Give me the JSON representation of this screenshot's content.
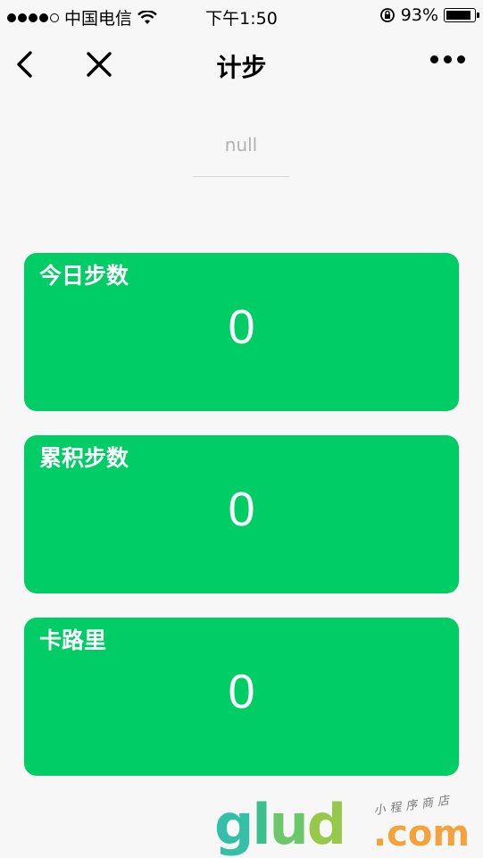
{
  "status_bar": {
    "carrier": "中国电信",
    "time": "下午1:50",
    "battery_percent": "93%",
    "battery_level": 0.93,
    "icons": [
      "signal-dots-icon",
      "wifi-icon",
      "rotation-lock-icon",
      "battery-icon"
    ]
  },
  "nav": {
    "title": "计步",
    "icons": [
      "back-arrow-icon",
      "close-icon",
      "more-icon"
    ]
  },
  "main": {
    "null_text": "null",
    "cards": [
      {
        "label": "今日步数",
        "value": "0"
      },
      {
        "label": "累积步数",
        "value": "0"
      },
      {
        "label": "卡路里",
        "value": "0"
      }
    ],
    "card_color": "#00cd65"
  },
  "watermark": {
    "main": "glud",
    "suffix": ".com",
    "subtitle": "小程序商店"
  }
}
